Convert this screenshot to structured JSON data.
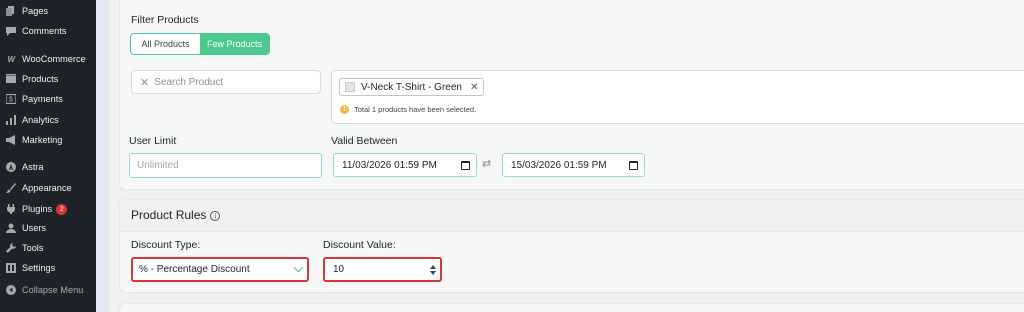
{
  "sidebar": {
    "items": [
      {
        "label": "Pages",
        "icon": "pages-icon"
      },
      {
        "label": "Comments",
        "icon": "comment-icon"
      },
      {
        "label": "WooCommerce",
        "icon": "woocommerce-icon"
      },
      {
        "label": "Products",
        "icon": "products-icon"
      },
      {
        "label": "Payments",
        "icon": "payments-icon"
      },
      {
        "label": "Analytics",
        "icon": "analytics-icon"
      },
      {
        "label": "Marketing",
        "icon": "megaphone-icon"
      },
      {
        "label": "Astra",
        "icon": "astra-icon"
      },
      {
        "label": "Appearance",
        "icon": "brush-icon"
      },
      {
        "label": "Plugins",
        "icon": "plugin-icon",
        "badge": "2"
      },
      {
        "label": "Users",
        "icon": "user-icon"
      },
      {
        "label": "Tools",
        "icon": "wrench-icon"
      },
      {
        "label": "Settings",
        "icon": "settings-icon"
      },
      {
        "label": "Collapse Menu",
        "icon": "collapse-icon"
      }
    ]
  },
  "filter": {
    "title": "Filter Products",
    "options": [
      "All Products",
      "Few Products"
    ],
    "active_option": "Few Products",
    "search_placeholder": "Search Product",
    "selected_product": "V-Neck T-Shirt - Green",
    "notice": "Total 1 products have been selected."
  },
  "limits": {
    "user_limit_label": "User Limit",
    "user_limit_placeholder": "Unlimited",
    "valid_between_label": "Valid Between",
    "start_date": "11/03/2026 01:59 PM",
    "end_date": "15/03/2026 01:59 PM"
  },
  "rules": {
    "title": "Product Rules",
    "discount_type_label": "Discount Type:",
    "discount_type_value": "% - Percentage Discount",
    "discount_value_label": "Discount Value:",
    "discount_value": "10"
  },
  "colors": {
    "accent_green": "#4cc98f",
    "highlight_red": "#d63638",
    "sidebar_bg": "#1d2327"
  }
}
